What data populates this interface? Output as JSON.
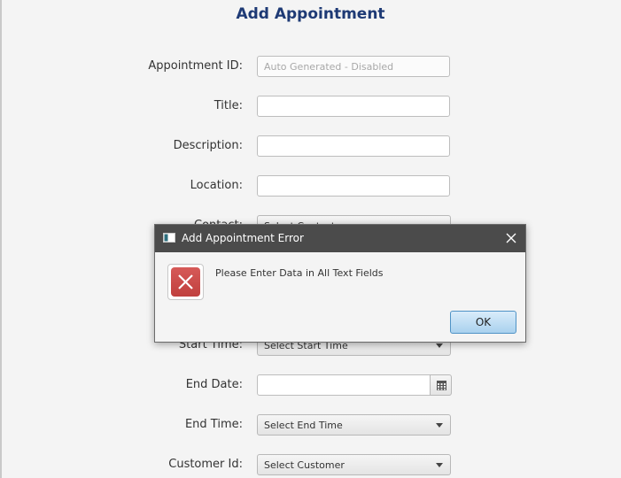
{
  "form": {
    "title": "Add Appointment",
    "fields": {
      "appointment_id": {
        "label": "Appointment ID:",
        "placeholder": "Auto Generated - Disabled"
      },
      "title": {
        "label": "Title:",
        "value": ""
      },
      "description": {
        "label": "Description:",
        "value": ""
      },
      "location": {
        "label": "Location:",
        "value": ""
      },
      "contact": {
        "label": "Contact:",
        "value": "Select Contact"
      },
      "start_time": {
        "label": "Start Time:",
        "value": "Select Start Time"
      },
      "end_date": {
        "label": "End Date:",
        "value": ""
      },
      "end_time": {
        "label": "End Time:",
        "value": "Select End Time"
      },
      "customer_id": {
        "label": "Customer Id:",
        "value": "Select Customer"
      }
    }
  },
  "dialog": {
    "title": "Add Appointment Error",
    "message": "Please Enter Data in All Text Fields",
    "ok_label": "OK",
    "icon": "error-icon",
    "error_color": "#c8484a"
  }
}
